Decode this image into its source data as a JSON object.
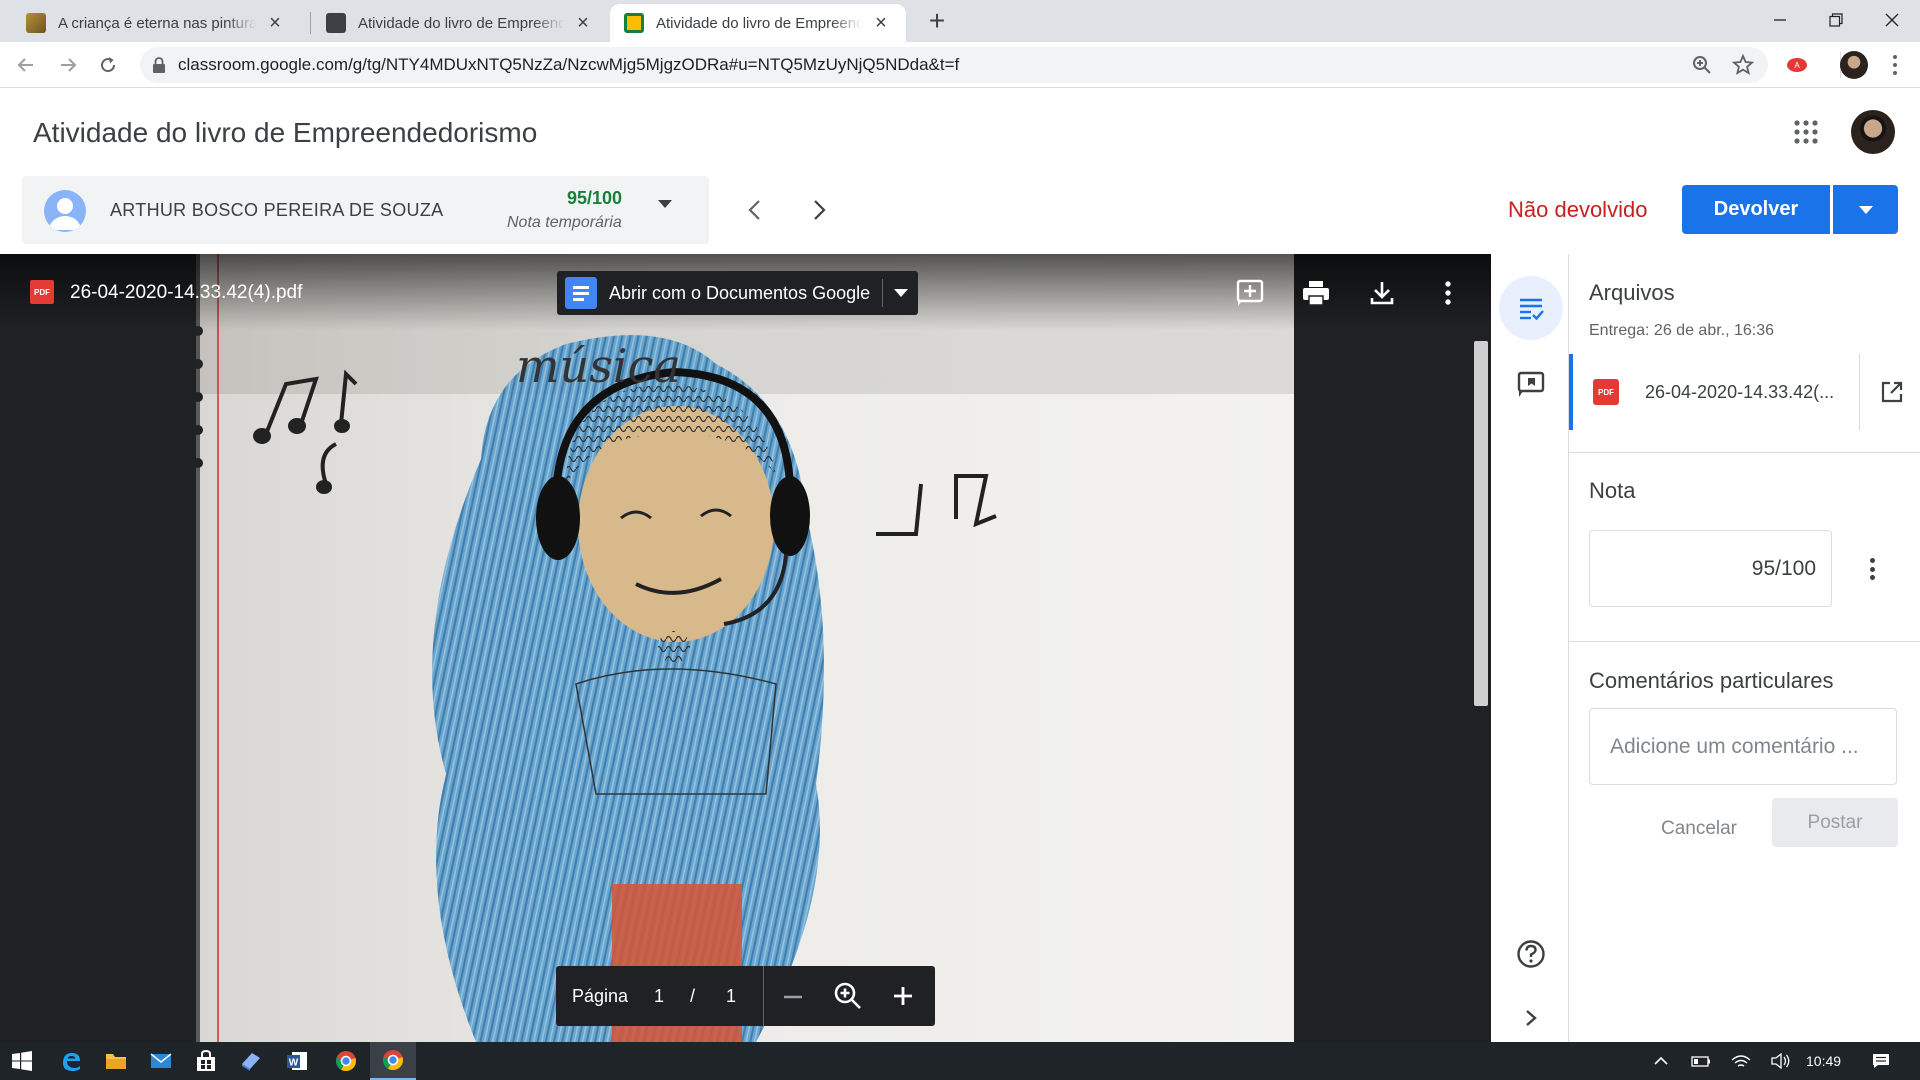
{
  "browser": {
    "tabs": [
      {
        "title": "A criança é eterna nas pinturas de",
        "close": "×"
      },
      {
        "title": "Atividade do livro de Empreendedorismo",
        "close": "×"
      },
      {
        "title": "Atividade do livro de Empreendedorismo",
        "close": "×",
        "active": true
      }
    ],
    "new_tab": "+",
    "url": "classroom.google.com/g/tg/NTY4MDUxNTQ5NzZa/NzcwMjg5MjgzODRa#u=NTQ5MzUyNjQ5NDda&t=f"
  },
  "header": {
    "title": "Atividade do livro de Empreendedorismo"
  },
  "student": {
    "name": "ARTHUR BOSCO PEREIRA DE SOUZA",
    "grade": "95/100",
    "grade_label": "Nota temporária"
  },
  "actions": {
    "status": "Não devolvido",
    "return_label": "Devolver"
  },
  "viewer": {
    "file_name": "26-04-2020-14.33.42(4).pdf",
    "pdf_badge": "PDF",
    "open_with": "Abrir com o Documentos Google",
    "page_label": "Página",
    "page_current": "1",
    "page_sep": "/",
    "page_total": "1",
    "drawing_text": "música"
  },
  "panel": {
    "files_heading": "Arquivos",
    "due": "Entrega: 26 de abr., 16:36",
    "file_name": "26-04-2020-14.33.42(...",
    "pdf_badge": "PDF",
    "grade_heading": "Nota",
    "grade_value": "95/100",
    "comments_heading": "Comentários particulares",
    "comment_placeholder": "Adicione um comentário ...",
    "cancel_label": "Cancelar",
    "post_label": "Postar"
  },
  "taskbar": {
    "time": "10:49"
  },
  "colors": {
    "accent": "#1a73e8",
    "grade_green": "#188038",
    "status_red": "#c5221f"
  }
}
